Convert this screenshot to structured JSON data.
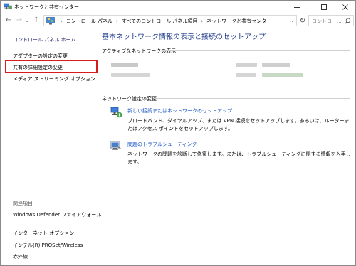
{
  "window": {
    "title": "ネットワークと共有センター",
    "controls": {
      "minimize": "minimize",
      "maximize": "maximize",
      "close": "close"
    }
  },
  "address_bar": {
    "crumbs": [
      "コントロール パネル",
      "すべてのコントロール パネル項目",
      "ネットワークと共有センター"
    ],
    "search_placeholder": "コントロー..."
  },
  "sidebar": {
    "home": "コントロール パネル ホーム",
    "items": [
      {
        "label": "アダプターの設定の変更"
      },
      {
        "label": "共有の詳細設定の変更"
      },
      {
        "label": "メディア ストリーミング オプション"
      }
    ],
    "see_also_title": "関連項目",
    "see_also": [
      {
        "label": "Windows Defender ファイアウォール"
      },
      {
        "label": "インターネット オプション"
      },
      {
        "label": "インテル(R) PROSet/Wireless"
      },
      {
        "label": "赤外線"
      }
    ]
  },
  "main": {
    "title": "基本ネットワーク情報の表示と接続のセットアップ",
    "active_networks_heading": "アクティブなネットワークの表示",
    "change_settings_heading": "ネットワーク設定の変更",
    "tasks": [
      {
        "link": "新しい接続またはネットワークのセットアップ",
        "description": "ブロードバンド、ダイヤルアップ、または VPN 接続をセットアップします。あるいは、ルーターまたはアクセス ポイントをセットアップします。",
        "icon": "network-setup-icon"
      },
      {
        "link": "問題のトラブルシューティング",
        "description": "ネットワークの問題を診断して修復します。または、トラブルシューティングに関する情報を入手します。",
        "icon": "troubleshoot-icon"
      }
    ]
  },
  "colors": {
    "highlight_box": "#d81b1b",
    "link": "#1a55c4",
    "title": "#1e3a8a"
  }
}
